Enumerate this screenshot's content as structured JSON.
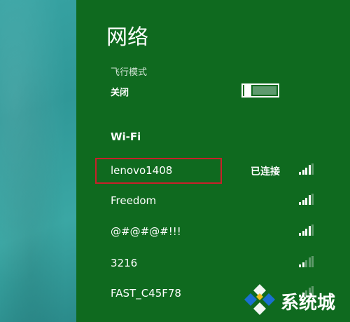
{
  "panel": {
    "title": "网络",
    "airplane_mode": {
      "label": "飞行模式",
      "state": "关闭",
      "enabled": false
    },
    "wifi": {
      "heading": "Wi-Fi",
      "networks": [
        {
          "name": "lenovo1408",
          "status": "已连接",
          "signal_bars": 4
        },
        {
          "name": "Freedom",
          "status": "",
          "signal_bars": 4
        },
        {
          "name": "@#@#@#!!!",
          "status": "",
          "signal_bars": 4
        },
        {
          "name": "3216",
          "status": "",
          "signal_bars": 2
        },
        {
          "name": "FAST_C45F78",
          "status": "",
          "signal_bars": 2
        }
      ]
    }
  },
  "watermark": {
    "text": "系统城",
    "icon": "diamond-logo-icon"
  },
  "colors": {
    "panel_bg": "#0f6a1f",
    "desktop_bg": "#2f9898",
    "highlight_border": "#c8202a",
    "toggle_fill": "#5e9a6e",
    "watermark_blue": "#1a6fd0"
  },
  "icons": {
    "signal": "wifi-signal-icon"
  }
}
